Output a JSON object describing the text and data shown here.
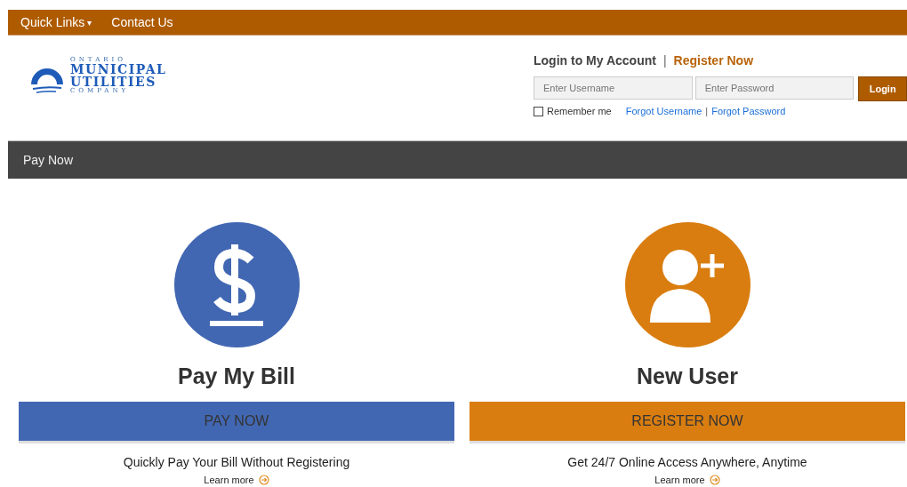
{
  "top_nav": [
    {
      "label": "Quick Links",
      "caret": "▾"
    },
    {
      "label": "Contact Us"
    }
  ],
  "logo": {
    "line_1": "ONTARIO",
    "line_2": "MUNICIPAL",
    "line_3": "UTILITIES",
    "line_4": "COMPANY"
  },
  "login": {
    "title": "Login to My Account",
    "separator": "|",
    "register_link": "Register Now",
    "username": {
      "placeholder": "Enter Username"
    },
    "password": {
      "placeholder": "Enter Password"
    },
    "button": "Login",
    "remember": {
      "label": "Remember me",
      "checked": false
    },
    "forgot_username": "Forgot Username",
    "link_separator": "|",
    "forgot_password": "Forgot Password"
  },
  "breadcrumb_bar": {
    "label": "Pay Now"
  },
  "cards": [
    {
      "kind": "pay",
      "color": "#4267b2",
      "title": "Pay My Bill",
      "button": "PAY NOW",
      "description": "Quickly Pay Your Bill Without Registering",
      "link": "Learn more"
    },
    {
      "kind": "register",
      "color": "#d97d10",
      "title": "New User",
      "button": "REGISTER NOW",
      "description": "Get 24/7 Online Access Anywhere, Anytime",
      "link": "Learn more"
    }
  ]
}
